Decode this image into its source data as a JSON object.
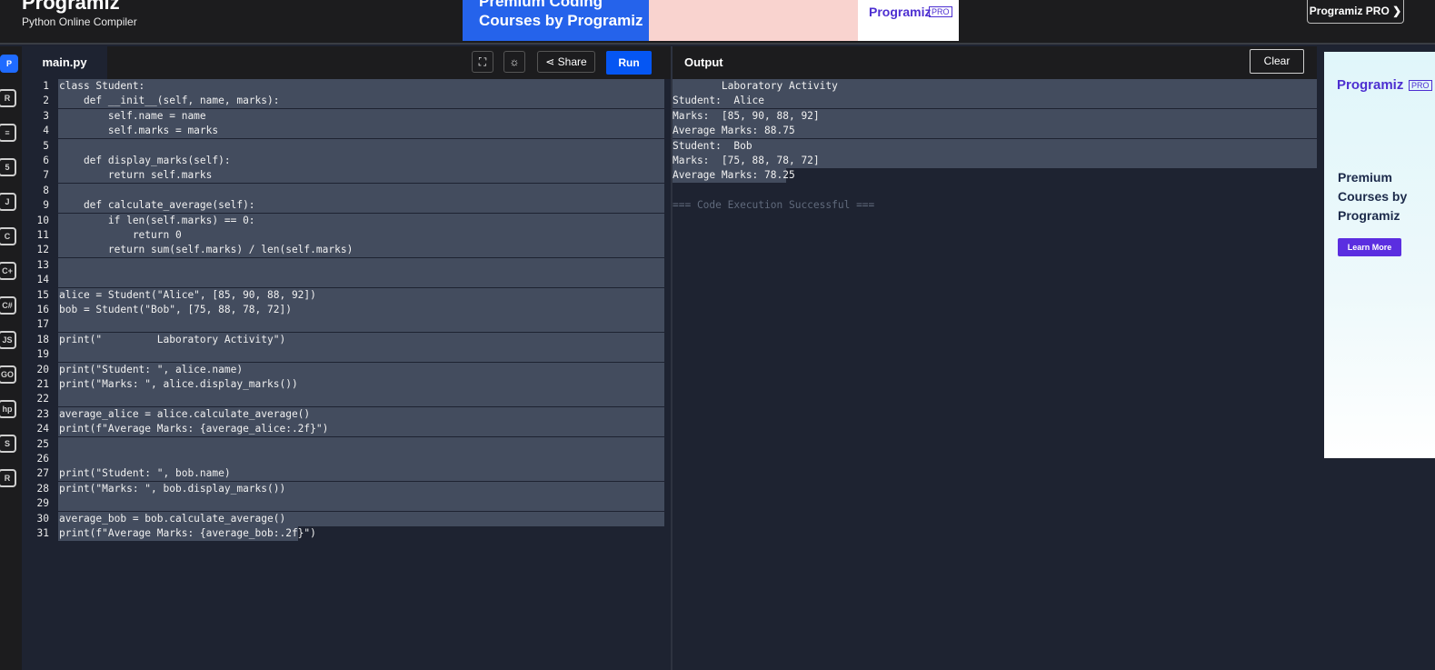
{
  "header": {
    "brand": "Programiz",
    "subtitle": "Python Online Compiler",
    "pro_button": "Programiz PRO ❯"
  },
  "banner": {
    "line1": "Premium Coding",
    "line2": "Courses by Programiz",
    "logo": "Programiz",
    "badge": "PRO"
  },
  "left_rail": [
    "python",
    "r",
    "sql",
    "html",
    "java",
    "c",
    "cpp",
    "csharp",
    "js",
    "go",
    "php",
    "swift",
    "rust"
  ],
  "editor": {
    "file_tab": "main.py",
    "share_label": "Share",
    "run_label": "Run",
    "line_numbers": [
      "1",
      "2",
      "3",
      "4",
      "5",
      "6",
      "7",
      "8",
      "9",
      "10",
      "11",
      "12",
      "13",
      "14",
      "15",
      "16",
      "17",
      "18",
      "19",
      "20",
      "21",
      "22",
      "23",
      "24",
      "25",
      "26",
      "27",
      "28",
      "29",
      "30",
      "31"
    ]
  },
  "output": {
    "title": "Output",
    "clear_label": "Clear",
    "lines": [
      "        Laboratory Activity",
      "Student:  Alice",
      "Marks:  [85, 90, 88, 92]",
      "Average Marks: 88.75",
      "Student:  Bob",
      "Marks:  [75, 88, 78, 72]",
      "Average Marks: 78.25"
    ],
    "status": "=== Code Execution Successful ==="
  },
  "side_ad": {
    "logo": "Programiz",
    "badge": "PRO",
    "headline": "Premium Courses by Programiz",
    "button": "Learn More"
  },
  "code_lines": [
    "class Student:",
    "    def __init__(self, name, marks):",
    "        self.name = name",
    "        self.marks = marks",
    "",
    "    def display_marks(self):",
    "        return self.marks",
    "",
    "    def calculate_average(self):",
    "        if len(self.marks) == 0:",
    "            return 0",
    "        return sum(self.marks) / len(self.marks)",
    "",
    "",
    "alice = Student(\"Alice\", [85, 90, 88, 92])",
    "bob = Student(\"Bob\", [75, 88, 78, 72])",
    "",
    "print(\"         Laboratory Activity\")",
    "",
    "print(\"Student: \", alice.name)",
    "print(\"Marks: \", alice.display_marks())",
    "",
    "average_alice = alice.calculate_average()",
    "print(f\"Average Marks: {average_alice:.2f}\")",
    "",
    "",
    "print(\"Student: \", bob.name)",
    "print(\"Marks: \", bob.display_marks())",
    "",
    "average_bob = bob.calculate_average()",
    "print(f\"Average Marks: {average_bob:.2f}\")"
  ],
  "colors": {
    "accent": "#0556f3",
    "editor_bg": "#1e2331",
    "selection": "#434c5e",
    "keyword": "#e0a35b",
    "string": "#a8b57a",
    "number": "#e0735f"
  }
}
